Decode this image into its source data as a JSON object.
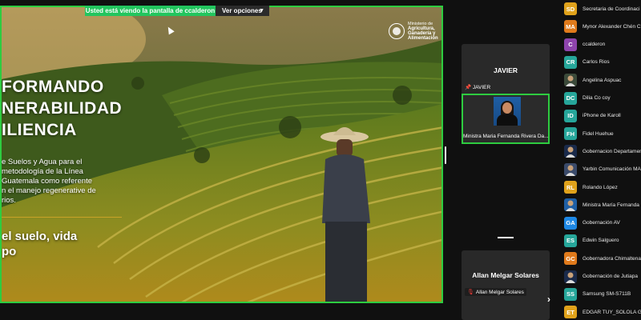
{
  "share": {
    "banner": "Usted está viendo la pantalla de  ccalderon",
    "view_options": "Ver opciones",
    "slide": {
      "title_lines": [
        "FORMANDO",
        "NERABILIDAD",
        "ILIENCIA"
      ],
      "body_lines": [
        "e Suelos y Agua para el",
        "metodología de la Línea",
        "Guatemala como referente",
        "n el manejo regenerative de",
        "rios."
      ],
      "slogan_lines": [
        "el suelo, vida",
        "po"
      ],
      "logo_lines": [
        "Ministerio de",
        "Agricultura,",
        "Ganadería y",
        "Alimentación"
      ]
    }
  },
  "tiles": {
    "top": {
      "name": "JAVIER",
      "pin_label": "JAVIER",
      "video_name": "Ministra Maria Fernanda Rivera Da..."
    },
    "bottom": {
      "name": "Allan Melgar Solares",
      "mic_label": "Allan Melgar Solares"
    }
  },
  "participants": [
    {
      "initials": "SD",
      "color": "#e0a21b",
      "name": "Secretaria de Coordinaci"
    },
    {
      "initials": "MA",
      "color": "#e07a1b",
      "name": "Mynor Alexander Chén Cu"
    },
    {
      "initials": "C",
      "color": "#8e44ad",
      "name": "ccalderon"
    },
    {
      "initials": "CR",
      "color": "#26a69a",
      "name": "Carlos Rios"
    },
    {
      "initials": "",
      "color": "#3b4a3a",
      "name": "Angelina Aspuac",
      "photo": true
    },
    {
      "initials": "DC",
      "color": "#26a69a",
      "name": "Dilia Co coy"
    },
    {
      "initials": "ID",
      "color": "#26a69a",
      "name": "iPhone de Karoll"
    },
    {
      "initials": "FH",
      "color": "#26a69a",
      "name": "Fidel Huehue"
    },
    {
      "initials": "",
      "color": "#1a2a4a",
      "name": "Gobernacion Departamen",
      "photo": true
    },
    {
      "initials": "",
      "color": "#3a4a6a",
      "name": "Yarbin Comunicación MAG",
      "photo": true
    },
    {
      "initials": "RL",
      "color": "#e0a21b",
      "name": "Rolando López"
    },
    {
      "initials": "",
      "color": "#1f5fa5",
      "name": "Ministra María Fernanda R",
      "photo": true
    },
    {
      "initials": "GA",
      "color": "#1e88e5",
      "name": "Gobernación AV"
    },
    {
      "initials": "ES",
      "color": "#26a69a",
      "name": "Edwin Salguero"
    },
    {
      "initials": "GC",
      "color": "#e07a1b",
      "name": "Gobernadora Chimaltenan"
    },
    {
      "initials": "",
      "color": "#1a2a4a",
      "name": "Gobernación de Jutiapa",
      "photo": true
    },
    {
      "initials": "SS",
      "color": "#26a69a",
      "name": "Samsung SM-S711B"
    },
    {
      "initials": "ET",
      "color": "#e0a21b",
      "name": "EDGAR TUY_SOLOLA GOB"
    }
  ]
}
